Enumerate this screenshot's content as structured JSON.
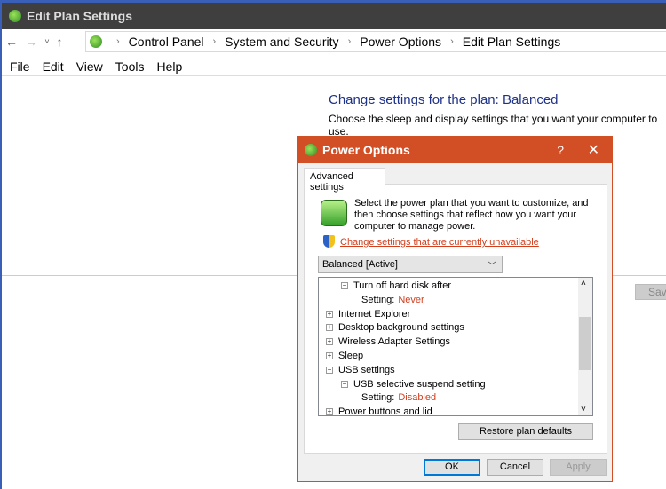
{
  "window": {
    "title": "Edit Plan Settings",
    "breadcrumb": [
      "Control Panel",
      "System and Security",
      "Power Options",
      "Edit Plan Settings"
    ],
    "menu": [
      "File",
      "Edit",
      "View",
      "Tools",
      "Help"
    ],
    "heading": "Change settings for the plan: Balanced",
    "subheading": "Choose the sleep and display settings that you want your computer to use.",
    "save_label": "Save"
  },
  "dialog": {
    "title": "Power Options",
    "help": "?",
    "close": "✕",
    "tab": "Advanced settings",
    "intro": "Select the power plan that you want to customize, and then choose settings that reflect how you want your computer to manage power.",
    "link": "Change settings that are currently unavailable",
    "plan": "Balanced [Active]",
    "tree": [
      {
        "label": "Turn off hard disk after",
        "level": 1,
        "toggle": "−"
      },
      {
        "label": "Setting:",
        "value": "Never",
        "level": 2
      },
      {
        "label": "Internet Explorer",
        "level": 0,
        "toggle": "+"
      },
      {
        "label": "Desktop background settings",
        "level": 0,
        "toggle": "+"
      },
      {
        "label": "Wireless Adapter Settings",
        "level": 0,
        "toggle": "+"
      },
      {
        "label": "Sleep",
        "level": 0,
        "toggle": "+"
      },
      {
        "label": "USB settings",
        "level": 0,
        "toggle": "−"
      },
      {
        "label": "USB selective suspend setting",
        "level": 1,
        "toggle": "−"
      },
      {
        "label": "Setting:",
        "value": "Disabled",
        "level": 2
      },
      {
        "label": "Power buttons and lid",
        "level": 0,
        "toggle": "+"
      }
    ],
    "restore": "Restore plan defaults",
    "ok": "OK",
    "cancel": "Cancel",
    "apply": "Apply"
  },
  "colors": {
    "accent": "#d24e25",
    "link": "#d2401f",
    "heading": "#1e3287"
  }
}
